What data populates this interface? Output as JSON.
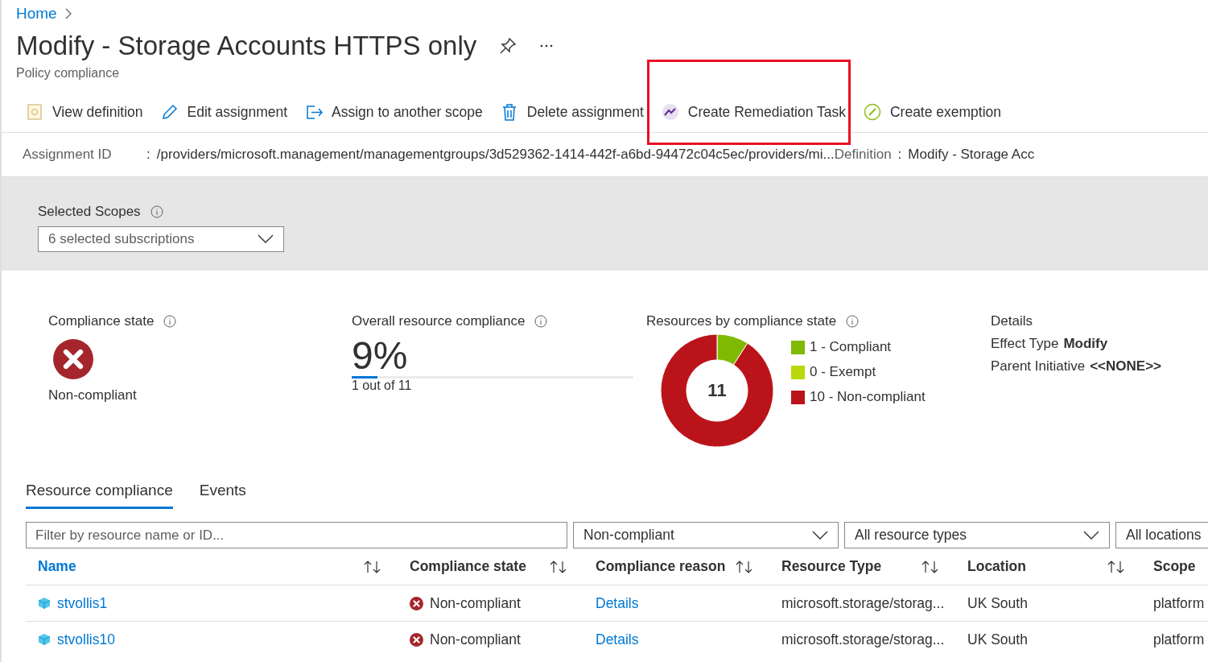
{
  "breadcrumb": [
    {
      "label": "Home"
    }
  ],
  "title": "Modify - Storage Accounts HTTPS only",
  "subtitle": "Policy compliance",
  "toolbar": [
    {
      "label": "View definition",
      "highlighted": false
    },
    {
      "label": "Edit assignment",
      "highlighted": false
    },
    {
      "label": "Assign to another scope",
      "highlighted": false
    },
    {
      "label": "Delete assignment",
      "highlighted": false
    },
    {
      "label": "Create Remediation Task",
      "highlighted": true
    },
    {
      "label": "Create exemption",
      "highlighted": false
    }
  ],
  "essentials": [
    {
      "label": "Assignment ID",
      "separator": ":",
      "value": "/providers/microsoft.management/managementgroups/3d529362-1414-442f-a6bd-94472c04c5ec/providers/mi..."
    },
    {
      "label": "Definition",
      "separator": ":",
      "value": "Modify - Storage Acc"
    }
  ],
  "scopes": {
    "label": "Selected Scopes",
    "value": "6 selected subscriptions"
  },
  "compliance_state": {
    "label": "Compliance state",
    "state": "Non-compliant"
  },
  "overall": {
    "label": "Overall resource compliance",
    "percent": "9%",
    "level": 0.09,
    "caption": "1 out of 11"
  },
  "resources": {
    "label": "Resources by compliance state",
    "total": "11",
    "legend": [
      {
        "color": "#7fba00"
      },
      {
        "color": "#bad80a"
      },
      {
        "color": "#ba141a"
      }
    ],
    "chart_data": {
      "type": "donut",
      "categories": [
        "1 - Compliant",
        "0 - Exempt",
        "10 - Non-compliant"
      ],
      "values": [
        1,
        0,
        10
      ]
    }
  },
  "details": {
    "title": "Details",
    "rows": [
      {
        "label": "Effect Type",
        "value": "Modify"
      },
      {
        "label": "Parent Initiative",
        "value": "<<NONE>>"
      }
    ]
  },
  "tabs": [
    {
      "label": "Resource compliance",
      "selected": true
    },
    {
      "label": "Events",
      "selected": false
    }
  ],
  "filters": {
    "placeholder": "Filter by resource name or ID...",
    "dropdowns": [
      "Non-compliant",
      "All resource types",
      "All locations"
    ]
  },
  "table": {
    "columns": [
      {
        "label": "Name",
        "sortable": true
      },
      {
        "label": "Compliance state",
        "sortable": true
      },
      {
        "label": "Compliance reason",
        "sortable": true
      },
      {
        "label": "Resource Type",
        "sortable": true
      },
      {
        "label": "Location",
        "sortable": true
      },
      {
        "label": "Scope",
        "sortable": false
      }
    ],
    "rows": [
      {
        "name": "stvollis1",
        "state": "Non-compliant",
        "reason": "Details",
        "type": "microsoft.storage/storag...",
        "location": "UK South",
        "scope": "platform"
      },
      {
        "name": "stvollis10",
        "state": "Non-compliant",
        "reason": "Details",
        "type": "microsoft.storage/storag...",
        "location": "UK South",
        "scope": "platform"
      }
    ]
  }
}
